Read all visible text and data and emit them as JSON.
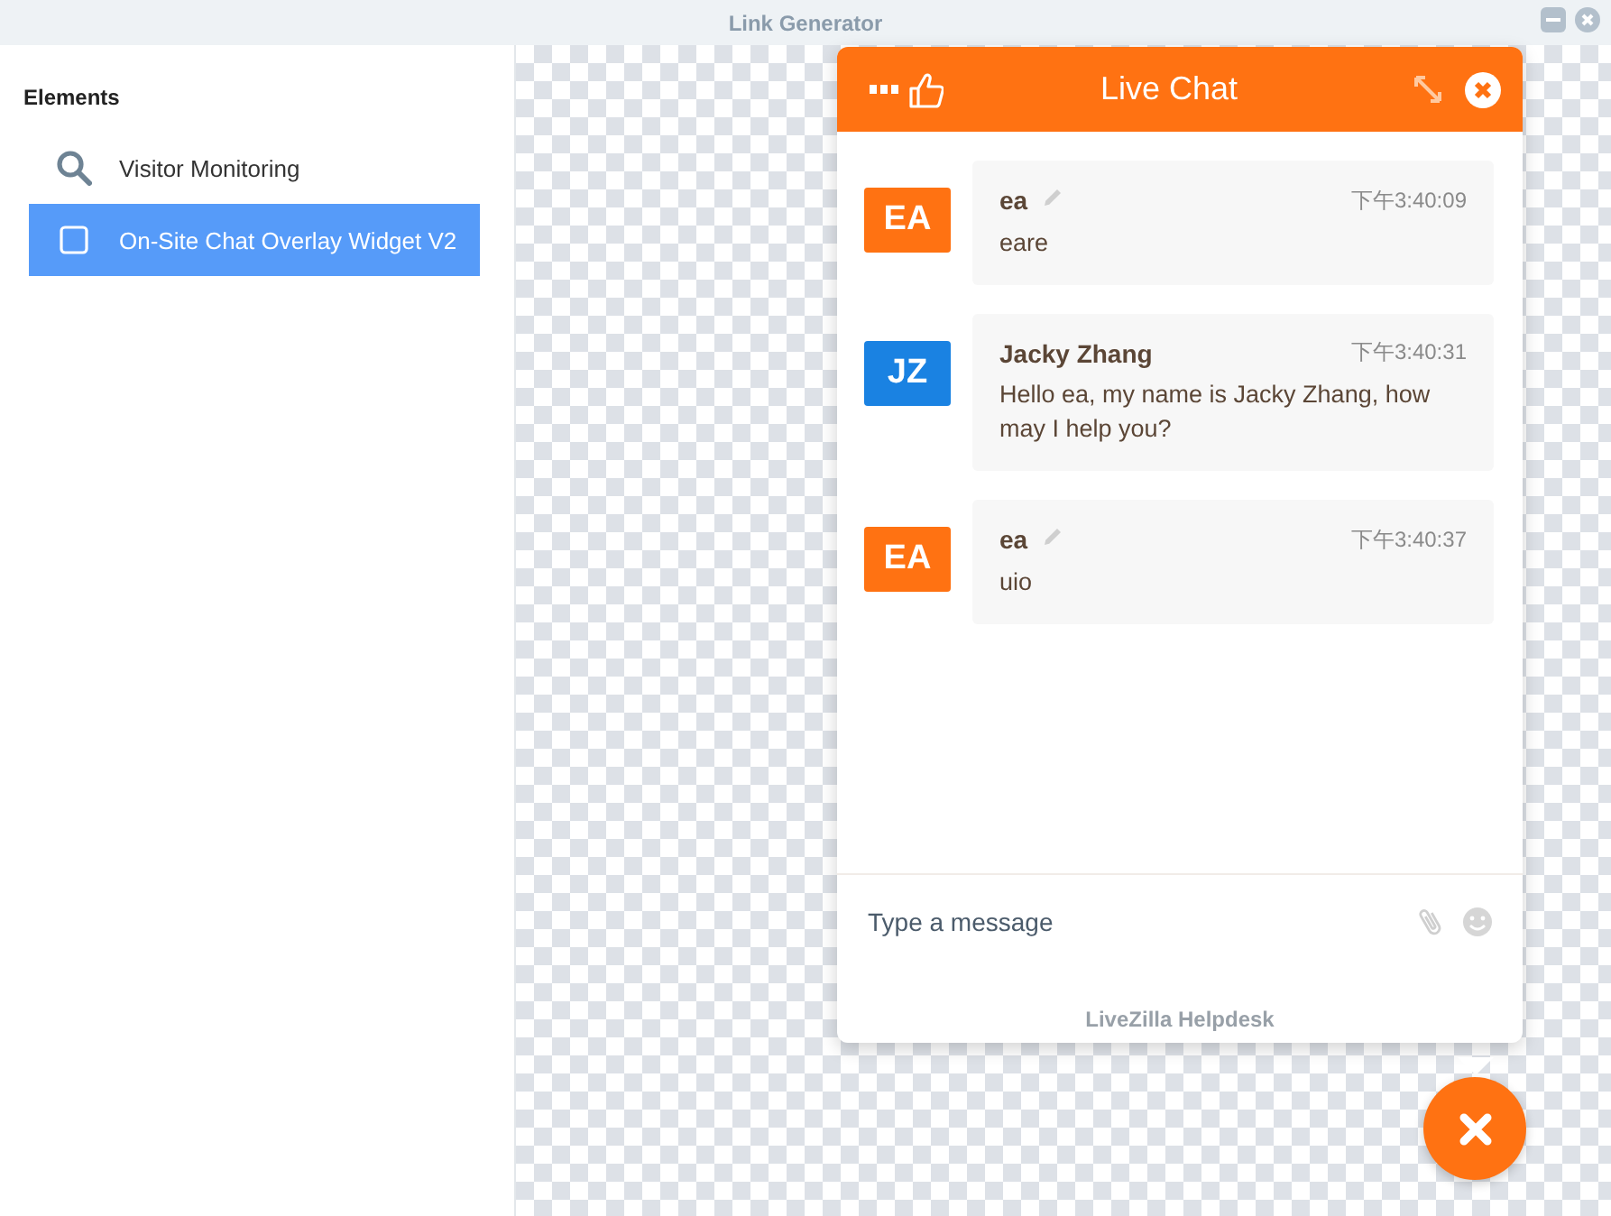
{
  "window": {
    "title": "Link Generator"
  },
  "sidebar": {
    "heading": "Elements",
    "items": [
      {
        "label": "Visitor Monitoring",
        "kind": "search",
        "selected": false
      },
      {
        "label": "On-Site Chat Overlay Widget V2",
        "kind": "widget",
        "selected": true
      }
    ]
  },
  "chat": {
    "title": "Live Chat",
    "messages": [
      {
        "initials": "EA",
        "color": "#ff7212",
        "name": "ea",
        "editable": true,
        "time": "下午3:40:09",
        "text": "eare"
      },
      {
        "initials": "JZ",
        "color": "#1a82e2",
        "name": "Jacky Zhang",
        "editable": false,
        "time": "下午3:40:31",
        "text": "Hello ea, my name is Jacky Zhang, how may I help you?"
      },
      {
        "initials": "EA",
        "color": "#ff7212",
        "name": "ea",
        "editable": true,
        "time": "下午3:40:37",
        "text": "uio"
      }
    ],
    "input": {
      "placeholder": "Type a message"
    },
    "footer": "LiveZilla Helpdesk"
  }
}
